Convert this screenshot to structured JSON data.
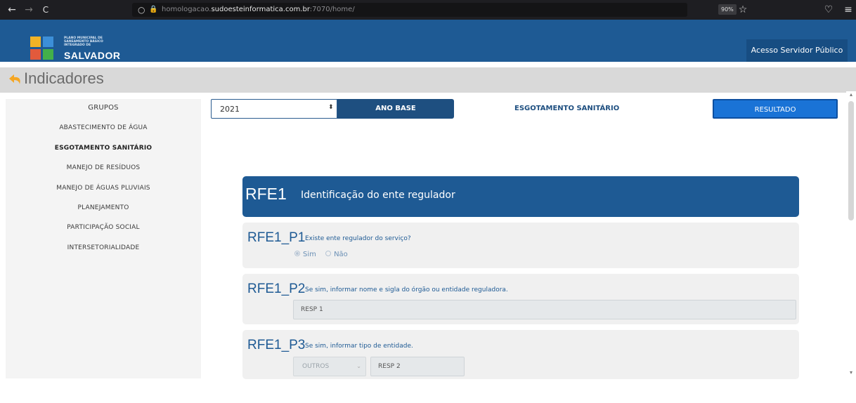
{
  "browser": {
    "url_prefix": "homologacao.",
    "url_domain": "sudoesteinformatica.com.br",
    "url_suffix": ":7070/home/",
    "zoom": "90%",
    "back_glyph": "←",
    "forward_glyph": "→",
    "reload_glyph": "C",
    "shield_glyph": "○",
    "lock_glyph": "🔒",
    "star_glyph": "☆",
    "pocket_glyph": "♡",
    "menu_glyph": "≡"
  },
  "header": {
    "logo_small_text": "PLANO MUNICIPAL DE SANEAMENTO BÁSICO INTEGRADO DE",
    "logo_city": "SALVADOR",
    "access_button": "Acesso Servidor Público",
    "brand_blue": "#1e5a94"
  },
  "page": {
    "title": "Indicadores"
  },
  "sidebar": {
    "heading": "GRUPOS",
    "items": [
      {
        "label": "ABASTECIMENTO DE ÁGUA"
      },
      {
        "label": "ESGOTAMENTO SANITÁRIO"
      },
      {
        "label": "MANEJO DE RESÍDUOS"
      },
      {
        "label": "MANEJO DE ÁGUAS PLUVIAIS"
      },
      {
        "label": "PLANEJAMENTO"
      },
      {
        "label": "PARTICIPAÇÃO SOCIAL"
      },
      {
        "label": "INTERSETORIALIDADE"
      }
    ],
    "active": "ESGOTAMENTO SANITÁRIO"
  },
  "toolbar": {
    "year_value": "2021",
    "year_arrow": "⬍",
    "ano_base": "ANO BASE",
    "group_label": "ESGOTAMENTO SANITÁRIO",
    "result_button": "RESULTADO"
  },
  "section": {
    "code": "RFE1",
    "title": "Identificação do ente regulador"
  },
  "questions": [
    {
      "code": "RFE1_P1",
      "text": "Existe ente regulador do serviço?",
      "options": [
        "Sim",
        "Não"
      ],
      "selected": "Sim"
    },
    {
      "code": "RFE1_P2",
      "text": "Se sim, informar nome e sigla do órgão ou entidade reguladora.",
      "value": "RESP 1"
    },
    {
      "code": "RFE1_P3",
      "text": "Se sim, informar tipo de entidade.",
      "select_value": "OUTROS",
      "value": "RESP 2"
    }
  ]
}
